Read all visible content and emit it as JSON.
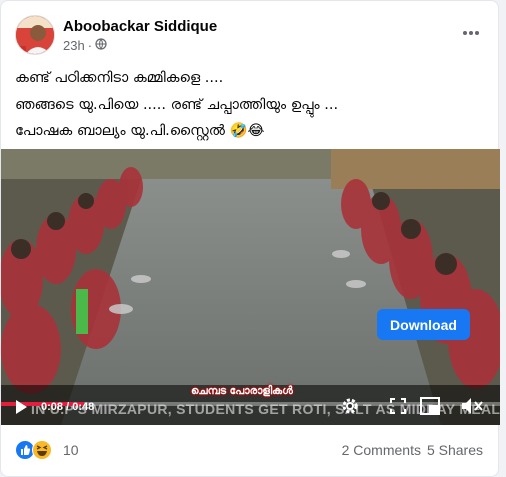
{
  "post": {
    "author": "Aboobackar Siddique",
    "time": "23h",
    "privacy_icon": "globe-icon",
    "more_icon": "more-options-icon",
    "lines": [
      "കണ്ട് പഠിക്കനിടാ കമ്മികളെ ....",
      "ഞങ്ങടെ യു.പിയെ ..... രണ്ട് ചപ്പാത്തിയും ഉപ്പും ...",
      "പോഷക ബാല്യം യു.പി.സ്റ്റൈൽ 🤣😂"
    ]
  },
  "video": {
    "download_label": "Download",
    "time_current": "0:08",
    "time_separator": "/",
    "time_total": "0:48",
    "progress": 0.167,
    "caption_text": "IN U.P'S MIRZAPUR, STUDENTS GET ROTI, SALT AS MIDDAY MEAL",
    "watermark_text": "ചെമ്പട പോരാളികൾ"
  },
  "footer": {
    "reaction_count": "10",
    "comments": "2 Comments",
    "shares": "5 Shares"
  },
  "colors": {
    "accent": "#1877f2",
    "progress": "#e41e3f"
  }
}
